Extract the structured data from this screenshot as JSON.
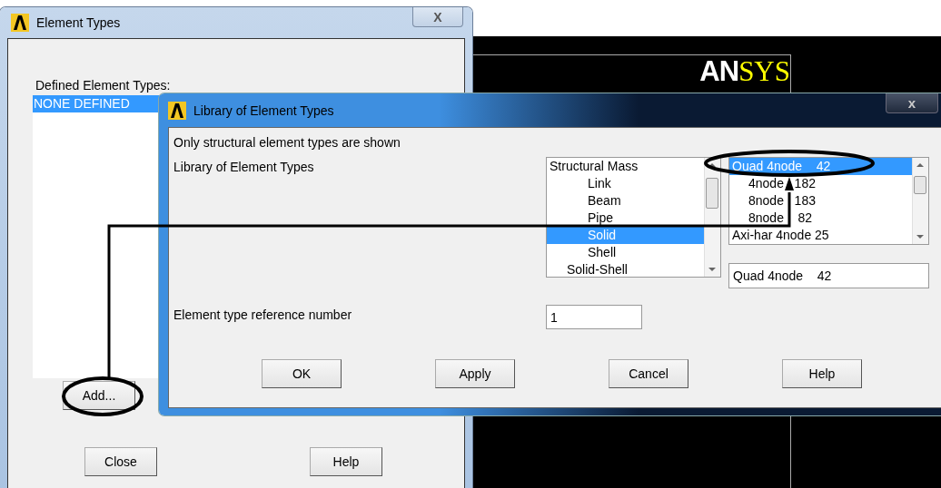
{
  "background_window": {
    "logo": {
      "white_part": "AN",
      "yellow_part": "SYS"
    }
  },
  "element_types_window": {
    "title": "Element Types",
    "close_button": "X",
    "list_label": "Defined Element Types:",
    "defined_types": [
      {
        "label": "NONE DEFINED",
        "selected": true
      }
    ],
    "buttons": [
      {
        "label": "Add...",
        "kind": "add"
      },
      {
        "label": "Close",
        "kind": "close"
      },
      {
        "label": "Help",
        "kind": "help"
      }
    ]
  },
  "library_dialog": {
    "title": "Library of Element Types",
    "close_button": "x",
    "note": "Only structural element types are shown",
    "library_label": "Library of Element Types",
    "categories": [
      {
        "label": "Structural Mass",
        "kind": "top",
        "selected": false
      },
      {
        "label": "Link",
        "kind": "sub",
        "selected": false
      },
      {
        "label": "Beam",
        "kind": "sub",
        "selected": false
      },
      {
        "label": "Pipe",
        "kind": "sub",
        "selected": false
      },
      {
        "label": "Solid",
        "kind": "sub",
        "selected": true
      },
      {
        "label": "Shell",
        "kind": "sub",
        "selected": false
      },
      {
        "label": "Solid-Shell",
        "kind": "mid",
        "selected": false
      }
    ],
    "element_types": [
      {
        "label": "Quad 4node    42",
        "kind": "top",
        "selected": true
      },
      {
        "label": "4node   182",
        "kind": "sub",
        "selected": false
      },
      {
        "label": "8node   183",
        "kind": "sub",
        "selected": false
      },
      {
        "label": "8node    82",
        "kind": "sub",
        "selected": false
      },
      {
        "label": "Axi-har 4node 25",
        "kind": "top",
        "selected": false
      }
    ],
    "selected_type_value": "Quad 4node    42",
    "reference_label": "Element type reference number",
    "reference_value": "1",
    "buttons": [
      "OK",
      "Apply",
      "Cancel",
      "Help"
    ]
  }
}
